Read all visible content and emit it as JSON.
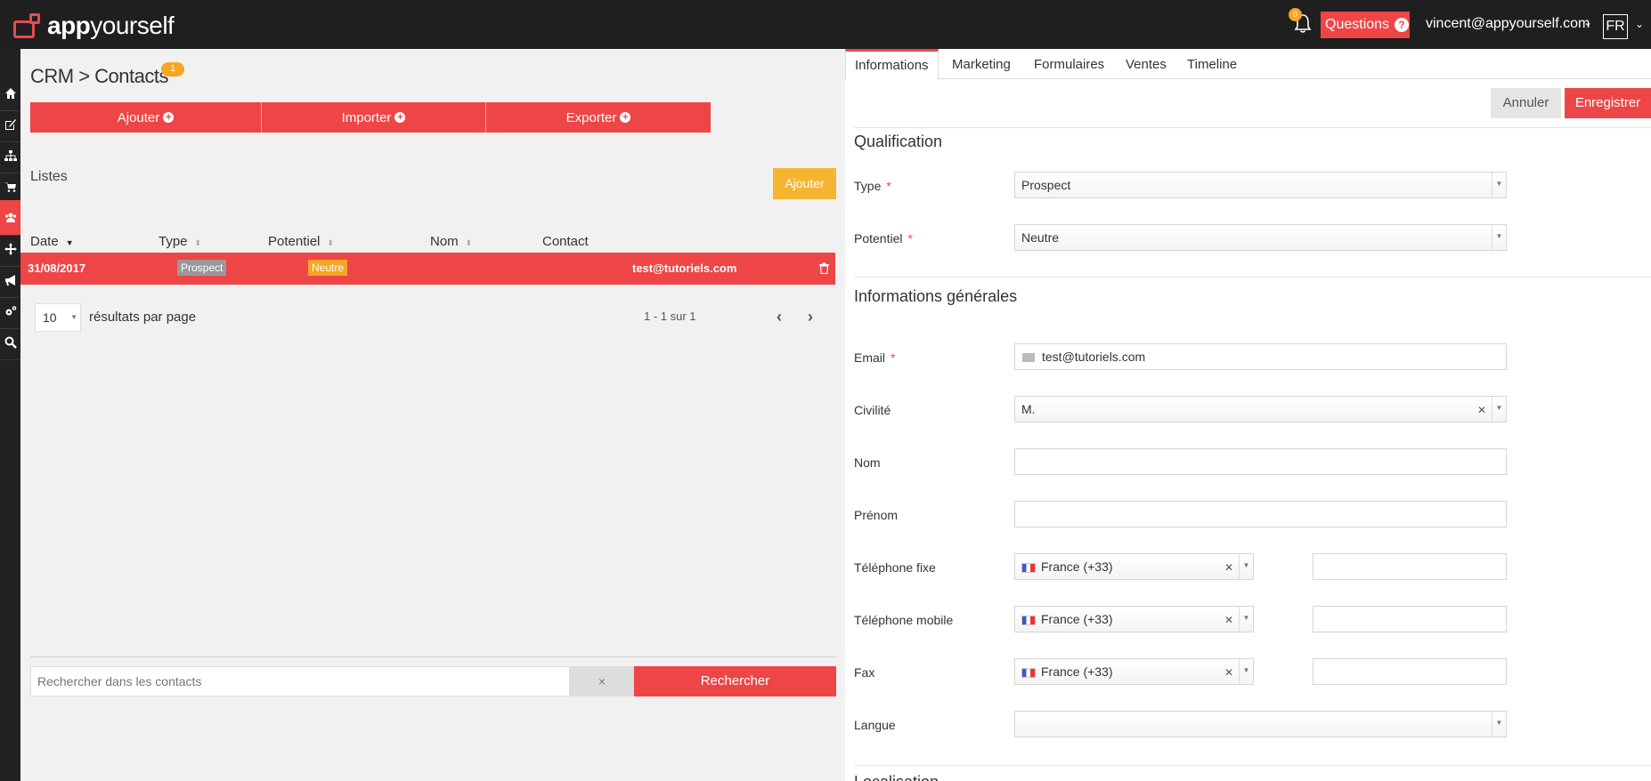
{
  "app": {
    "name_bold": "app",
    "name_rest": "yourself"
  },
  "topbar": {
    "notifications_count": "0",
    "questions_label": "Questions",
    "questions_icon": "?",
    "user_email": "vincent@appyourself.com",
    "language": "FR"
  },
  "nav": [
    "home-icon",
    "edit-icon",
    "sitemap-icon",
    "cart-icon",
    "users-icon",
    "move-icon",
    "megaphone-icon",
    "cogs-icon",
    "search-icon"
  ],
  "left": {
    "title": "CRM > Contacts",
    "title_badge": "1",
    "actions": [
      {
        "label": "Ajouter"
      },
      {
        "label": "Importer"
      },
      {
        "label": "Exporter"
      }
    ],
    "lists_label": "Listes",
    "lists_add": "Ajouter",
    "table": {
      "headers": [
        "Date",
        "Type",
        "Potentiel",
        "Nom",
        "Contact"
      ],
      "rows": [
        {
          "date": "31/08/2017",
          "type": "Prospect",
          "potentiel": "Neutre",
          "nom": "",
          "contact": "test@tutoriels.com"
        }
      ]
    },
    "per_page_value": "10",
    "per_page_label": "résultats par page",
    "page_info": "1 - 1 sur 1",
    "search_placeholder": "Rechercher dans les contacts",
    "search_clear": "×",
    "search_button": "Rechercher"
  },
  "right": {
    "tabs": [
      "Informations",
      "Marketing",
      "Formulaires",
      "Ventes",
      "Timeline"
    ],
    "cancel": "Annuler",
    "save": "Enregistrer",
    "qualification_title": "Qualification",
    "type_label": "Type",
    "type_value": "Prospect",
    "potentiel_label": "Potentiel",
    "potentiel_value": "Neutre",
    "general_title": "Informations générales",
    "email_label": "Email",
    "email_value": "test@tutoriels.com",
    "civilite_label": "Civilité",
    "civilite_value": "M.",
    "nom_label": "Nom",
    "prenom_label": "Prénom",
    "tel_fixe_label": "Téléphone fixe",
    "tel_mobile_label": "Téléphone mobile",
    "fax_label": "Fax",
    "country_value": "France (+33)",
    "langue_label": "Langue",
    "localisation_title": "Localisation"
  },
  "colors": {
    "accent": "#ee4547",
    "warning": "#f6a623",
    "topbar": "#1f1f1f"
  }
}
